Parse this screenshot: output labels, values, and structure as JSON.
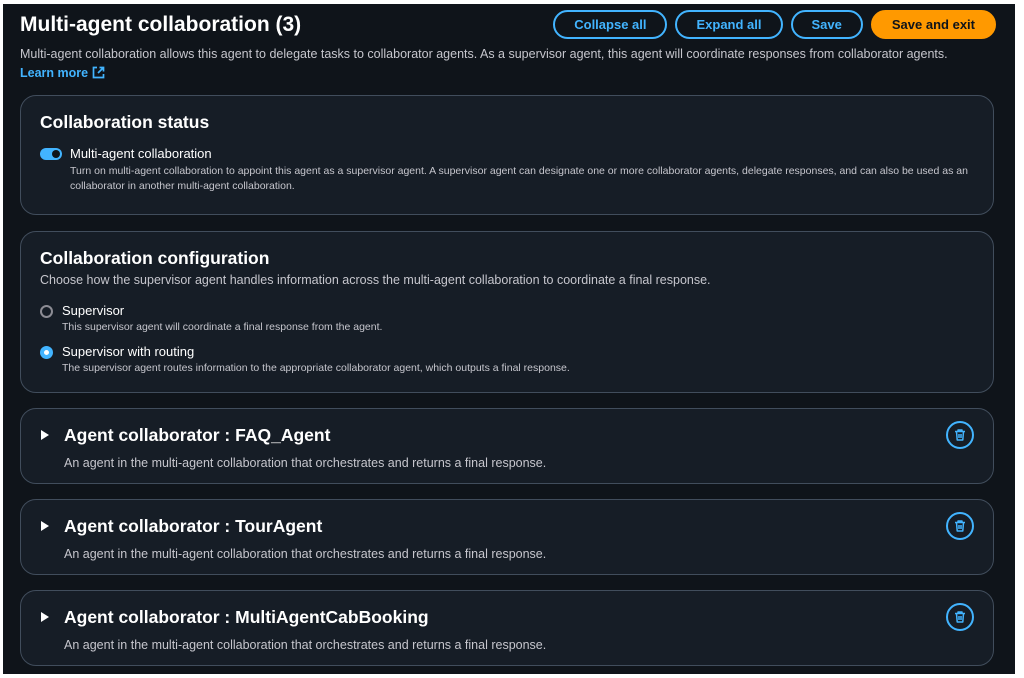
{
  "header": {
    "title": "Multi-agent collaboration (3)",
    "description": "Multi-agent collaboration allows this agent to delegate tasks to collaborator agents. As a supervisor agent, this agent will coordinate responses from collaborator agents.",
    "learn_more": "Learn more",
    "buttons": {
      "collapse_all": "Collapse all",
      "expand_all": "Expand all",
      "save": "Save",
      "save_and_exit": "Save and exit"
    }
  },
  "status": {
    "heading": "Collaboration status",
    "toggle_label": "Multi-agent collaboration",
    "toggle_on": true,
    "toggle_description": "Turn on multi-agent collaboration to appoint this agent as a supervisor agent. A supervisor agent can designate one or more collaborator agents, delegate responses, and can also be used as an collaborator in another multi-agent collaboration."
  },
  "configuration": {
    "heading": "Collaboration configuration",
    "description": "Choose how the supervisor agent handles information across the multi-agent collaboration to coordinate a final response.",
    "selected": "Supervisor with routing",
    "options": [
      {
        "label": "Supervisor",
        "description": "This supervisor agent will coordinate a final response from the agent."
      },
      {
        "label": "Supervisor with routing",
        "description": "The supervisor agent routes information to the appropriate collaborator agent, which outputs a final response."
      }
    ]
  },
  "collaborators": [
    {
      "title": "Agent collaborator : FAQ_Agent",
      "description": "An agent in the multi-agent collaboration that orchestrates and returns a final response."
    },
    {
      "title": "Agent collaborator : TourAgent",
      "description": "An agent in the multi-agent collaboration that orchestrates and returns a final response."
    },
    {
      "title": "Agent collaborator : MultiAgentCabBooking",
      "description": "An agent in the multi-agent collaboration that orchestrates and returns a final response."
    }
  ],
  "colors": {
    "background": "#0f141a",
    "panel": "#161d26",
    "accent": "#42b4ff",
    "primary_button": "#ff9900"
  },
  "icons": {
    "toggle": "toggle-switch-icon",
    "external": "external-link-icon",
    "expand": "caret-right-icon",
    "delete": "trash-icon"
  }
}
